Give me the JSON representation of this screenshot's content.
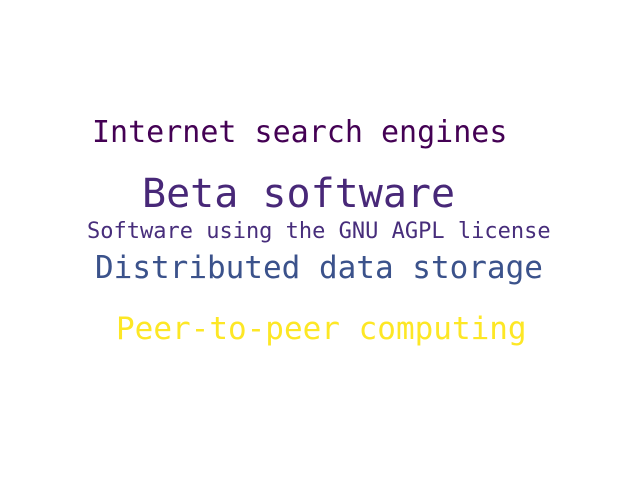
{
  "words": [
    {
      "text": "Internet search engines",
      "color": "#440154"
    },
    {
      "text": "Beta software",
      "color": "#482878"
    },
    {
      "text": "Software using the GNU AGPL license",
      "color": "#472d7b"
    },
    {
      "text": "Distributed data storage",
      "color": "#3b528b"
    },
    {
      "text": "Peer-to-peer computing",
      "color": "#fde725"
    }
  ]
}
